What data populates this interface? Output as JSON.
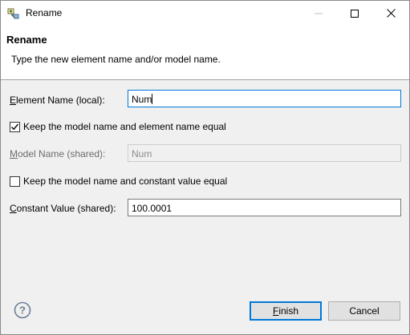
{
  "window": {
    "title": "Rename",
    "controls": {
      "minimize": "minimize",
      "maximize": "maximize",
      "close": "close"
    }
  },
  "header": {
    "title": "Rename",
    "description": "Type the new element name and/or model name."
  },
  "form": {
    "element_name": {
      "label_mnemonic": "E",
      "label_rest": "lement Name (local):",
      "value": "Num",
      "focused": true
    },
    "keep_equal_name": {
      "label": "Keep the model name and element name equal",
      "checked": true
    },
    "model_name": {
      "label_mnemonic": "M",
      "label_rest": "odel Name (shared):",
      "value": "Num",
      "enabled": false
    },
    "keep_equal_constant": {
      "label": "Keep the model name and constant value equal",
      "checked": false
    },
    "constant_value": {
      "label_mnemonic": "C",
      "label_rest": "onstant Value (shared):",
      "value": "100.0001"
    }
  },
  "footer": {
    "help_icon": "help-circle-icon",
    "finish_mnemonic": "F",
    "finish_rest": "inish",
    "cancel_label": "Cancel"
  },
  "colors": {
    "focus_border": "#0078d7",
    "dialog_bg": "#f0f0f0",
    "header_bg": "#ffffff"
  }
}
